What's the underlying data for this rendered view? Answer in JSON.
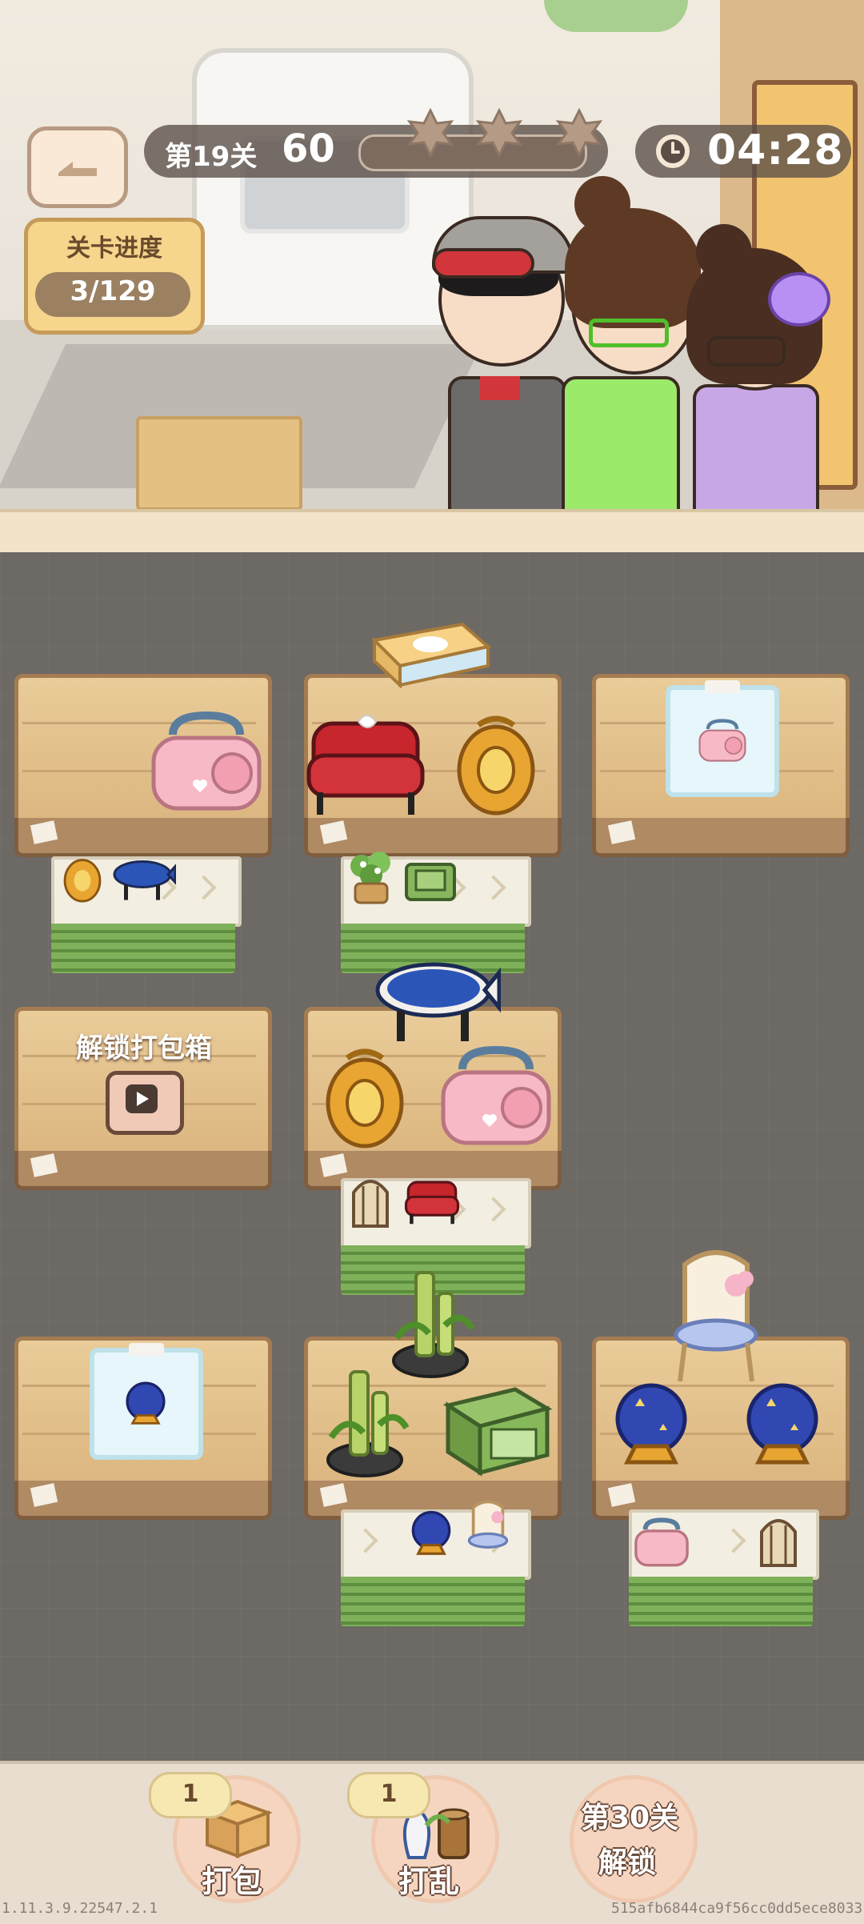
{
  "header": {
    "level_label": "第19关",
    "score": "60",
    "stars_filled": 0,
    "timer": "04:28",
    "progress_title": "关卡进度",
    "progress_value": "3/129"
  },
  "board": {
    "locked_label": "解锁打包箱"
  },
  "toolbar": {
    "pack_label": "打包",
    "pack_count": "1",
    "shuffle_label": "打乱",
    "shuffle_count": "1",
    "unlock_line1": "第30关",
    "unlock_line2": "解锁"
  },
  "footer": {
    "version": "1.11.3.9.22547.2.1",
    "build_hash": "515afb6844ca9f56cc0dd5ece8033f1f"
  },
  "icons": [
    "back-arrow-icon",
    "star-icon",
    "clock-icon",
    "video-icon",
    "pink-radio-item",
    "red-armchair-item",
    "golden-lantern-item",
    "tissue-box-item",
    "blue-fish-table-item",
    "potted-plant-item",
    "green-cabinet-item",
    "crystal-ball-item",
    "bamboo-fountain-item",
    "rattan-chair-item",
    "birdcage-lamp-item",
    "box-icon",
    "vase-icon"
  ]
}
